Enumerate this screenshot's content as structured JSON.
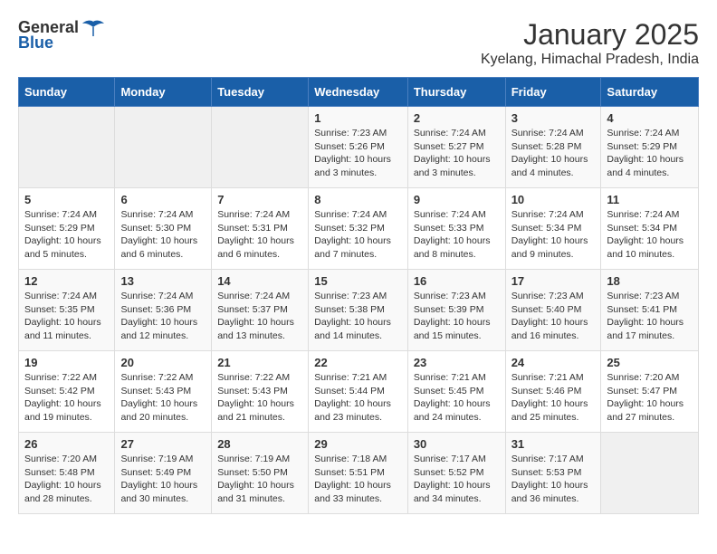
{
  "header": {
    "logo_general": "General",
    "logo_blue": "Blue",
    "title": "January 2025",
    "subtitle": "Kyelang, Himachal Pradesh, India"
  },
  "days_of_week": [
    "Sunday",
    "Monday",
    "Tuesday",
    "Wednesday",
    "Thursday",
    "Friday",
    "Saturday"
  ],
  "weeks": [
    [
      {
        "day": "",
        "empty": true
      },
      {
        "day": "",
        "empty": true
      },
      {
        "day": "",
        "empty": true
      },
      {
        "day": "1",
        "sunrise": "7:23 AM",
        "sunset": "5:26 PM",
        "daylight": "10 hours and 3 minutes."
      },
      {
        "day": "2",
        "sunrise": "7:24 AM",
        "sunset": "5:27 PM",
        "daylight": "10 hours and 3 minutes."
      },
      {
        "day": "3",
        "sunrise": "7:24 AM",
        "sunset": "5:28 PM",
        "daylight": "10 hours and 4 minutes."
      },
      {
        "day": "4",
        "sunrise": "7:24 AM",
        "sunset": "5:29 PM",
        "daylight": "10 hours and 4 minutes."
      }
    ],
    [
      {
        "day": "5",
        "sunrise": "7:24 AM",
        "sunset": "5:29 PM",
        "daylight": "10 hours and 5 minutes."
      },
      {
        "day": "6",
        "sunrise": "7:24 AM",
        "sunset": "5:30 PM",
        "daylight": "10 hours and 6 minutes."
      },
      {
        "day": "7",
        "sunrise": "7:24 AM",
        "sunset": "5:31 PM",
        "daylight": "10 hours and 6 minutes."
      },
      {
        "day": "8",
        "sunrise": "7:24 AM",
        "sunset": "5:32 PM",
        "daylight": "10 hours and 7 minutes."
      },
      {
        "day": "9",
        "sunrise": "7:24 AM",
        "sunset": "5:33 PM",
        "daylight": "10 hours and 8 minutes."
      },
      {
        "day": "10",
        "sunrise": "7:24 AM",
        "sunset": "5:34 PM",
        "daylight": "10 hours and 9 minutes."
      },
      {
        "day": "11",
        "sunrise": "7:24 AM",
        "sunset": "5:34 PM",
        "daylight": "10 hours and 10 minutes."
      }
    ],
    [
      {
        "day": "12",
        "sunrise": "7:24 AM",
        "sunset": "5:35 PM",
        "daylight": "10 hours and 11 minutes."
      },
      {
        "day": "13",
        "sunrise": "7:24 AM",
        "sunset": "5:36 PM",
        "daylight": "10 hours and 12 minutes."
      },
      {
        "day": "14",
        "sunrise": "7:24 AM",
        "sunset": "5:37 PM",
        "daylight": "10 hours and 13 minutes."
      },
      {
        "day": "15",
        "sunrise": "7:23 AM",
        "sunset": "5:38 PM",
        "daylight": "10 hours and 14 minutes."
      },
      {
        "day": "16",
        "sunrise": "7:23 AM",
        "sunset": "5:39 PM",
        "daylight": "10 hours and 15 minutes."
      },
      {
        "day": "17",
        "sunrise": "7:23 AM",
        "sunset": "5:40 PM",
        "daylight": "10 hours and 16 minutes."
      },
      {
        "day": "18",
        "sunrise": "7:23 AM",
        "sunset": "5:41 PM",
        "daylight": "10 hours and 17 minutes."
      }
    ],
    [
      {
        "day": "19",
        "sunrise": "7:22 AM",
        "sunset": "5:42 PM",
        "daylight": "10 hours and 19 minutes."
      },
      {
        "day": "20",
        "sunrise": "7:22 AM",
        "sunset": "5:43 PM",
        "daylight": "10 hours and 20 minutes."
      },
      {
        "day": "21",
        "sunrise": "7:22 AM",
        "sunset": "5:43 PM",
        "daylight": "10 hours and 21 minutes."
      },
      {
        "day": "22",
        "sunrise": "7:21 AM",
        "sunset": "5:44 PM",
        "daylight": "10 hours and 23 minutes."
      },
      {
        "day": "23",
        "sunrise": "7:21 AM",
        "sunset": "5:45 PM",
        "daylight": "10 hours and 24 minutes."
      },
      {
        "day": "24",
        "sunrise": "7:21 AM",
        "sunset": "5:46 PM",
        "daylight": "10 hours and 25 minutes."
      },
      {
        "day": "25",
        "sunrise": "7:20 AM",
        "sunset": "5:47 PM",
        "daylight": "10 hours and 27 minutes."
      }
    ],
    [
      {
        "day": "26",
        "sunrise": "7:20 AM",
        "sunset": "5:48 PM",
        "daylight": "10 hours and 28 minutes."
      },
      {
        "day": "27",
        "sunrise": "7:19 AM",
        "sunset": "5:49 PM",
        "daylight": "10 hours and 30 minutes."
      },
      {
        "day": "28",
        "sunrise": "7:19 AM",
        "sunset": "5:50 PM",
        "daylight": "10 hours and 31 minutes."
      },
      {
        "day": "29",
        "sunrise": "7:18 AM",
        "sunset": "5:51 PM",
        "daylight": "10 hours and 33 minutes."
      },
      {
        "day": "30",
        "sunrise": "7:17 AM",
        "sunset": "5:52 PM",
        "daylight": "10 hours and 34 minutes."
      },
      {
        "day": "31",
        "sunrise": "7:17 AM",
        "sunset": "5:53 PM",
        "daylight": "10 hours and 36 minutes."
      },
      {
        "day": "",
        "empty": true
      }
    ]
  ],
  "labels": {
    "sunrise": "Sunrise:",
    "sunset": "Sunset:",
    "daylight": "Daylight:"
  }
}
